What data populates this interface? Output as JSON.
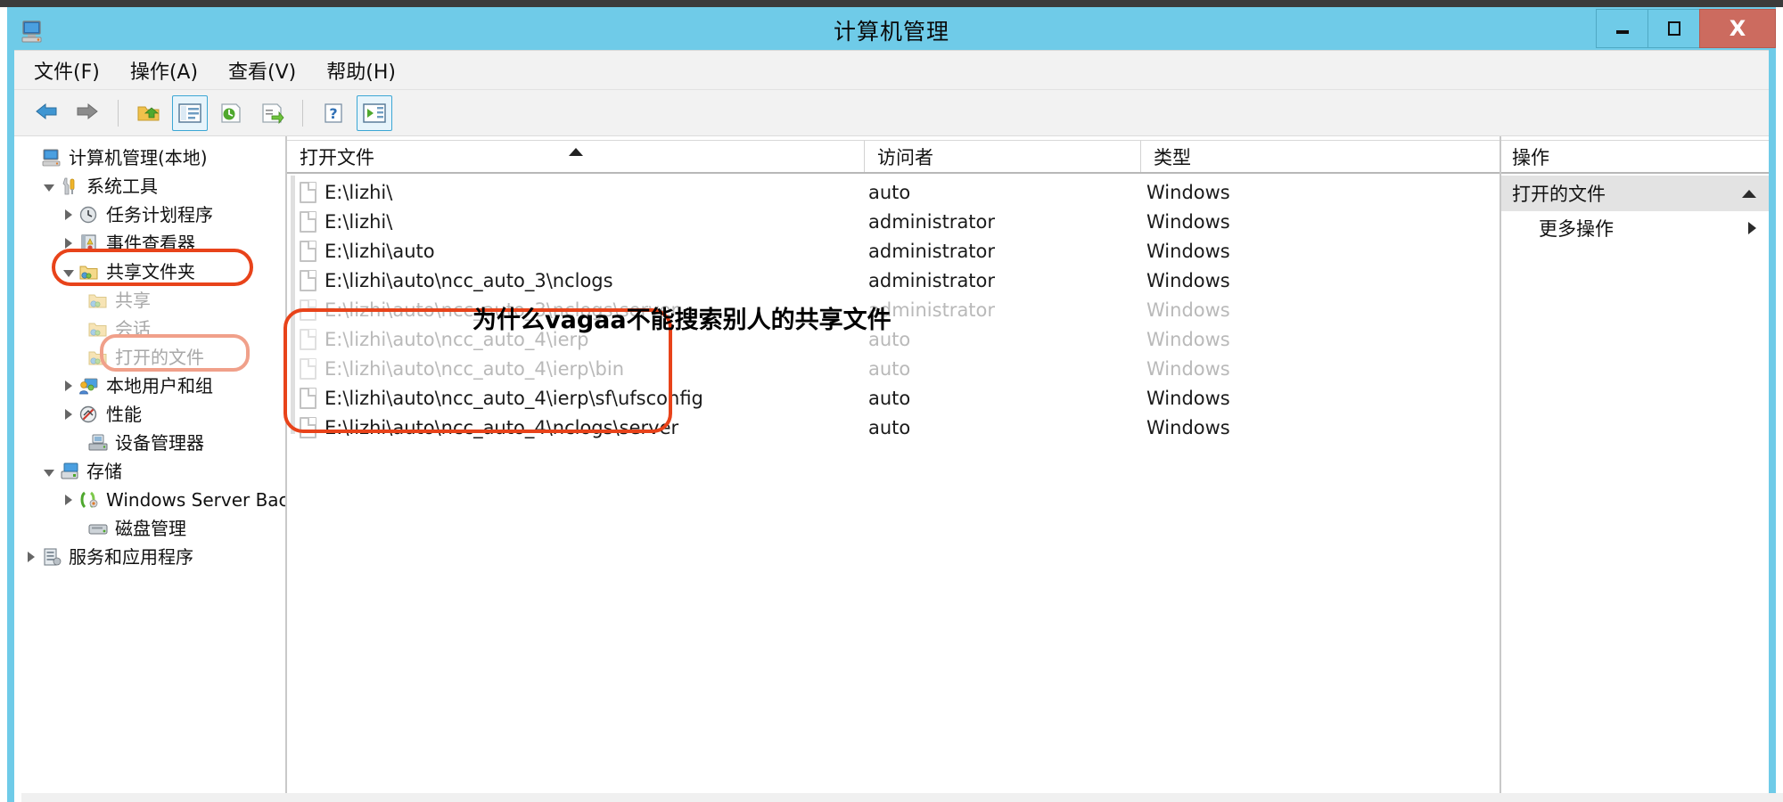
{
  "window": {
    "title": "计算机管理",
    "icon": "computer-management-icon",
    "controls": {
      "minimize": "–",
      "maximize": "□",
      "close": "X"
    }
  },
  "menubar": {
    "items": [
      {
        "label": "文件(F)",
        "name": "menu-file"
      },
      {
        "label": "操作(A)",
        "name": "menu-action"
      },
      {
        "label": "查看(V)",
        "name": "menu-view"
      },
      {
        "label": "帮助(H)",
        "name": "menu-help"
      }
    ]
  },
  "toolbar": {
    "buttons": [
      {
        "name": "back-icon",
        "glyph": "back"
      },
      {
        "name": "forward-icon",
        "glyph": "forward"
      },
      {
        "name": "up-folder-icon",
        "glyph": "folder-up"
      },
      {
        "name": "show-hide-tree-icon",
        "glyph": "tree-pane",
        "active": true
      },
      {
        "name": "refresh-icon",
        "glyph": "refresh"
      },
      {
        "name": "export-list-icon",
        "glyph": "export"
      },
      {
        "name": "help-icon",
        "glyph": "help"
      },
      {
        "name": "show-action-pane-icon",
        "glyph": "action-pane",
        "active": true
      }
    ]
  },
  "tree": {
    "items": [
      {
        "label": "计算机管理(本地)",
        "indent": 0,
        "arrow": "none",
        "icon": "computer-icon",
        "dim": false
      },
      {
        "label": "系统工具",
        "indent": 1,
        "arrow": "expanded",
        "icon": "tools-icon",
        "dim": false
      },
      {
        "label": "任务计划程序",
        "indent": 2,
        "arrow": "collapsed",
        "icon": "clock-icon",
        "dim": false
      },
      {
        "label": "事件查看器",
        "indent": 2,
        "arrow": "collapsed",
        "icon": "event-log-icon",
        "dim": false
      },
      {
        "label": "共享文件夹",
        "indent": 2,
        "arrow": "expanded",
        "icon": "shared-folder-icon",
        "dim": false
      },
      {
        "label": "共享",
        "indent": 3,
        "arrow": "none",
        "icon": "shared-folder-icon",
        "dim": true
      },
      {
        "label": "会话",
        "indent": 3,
        "arrow": "none",
        "icon": "shared-folder-icon",
        "dim": true
      },
      {
        "label": "打开的文件",
        "indent": 3,
        "arrow": "none",
        "icon": "shared-folder-icon",
        "dim": true
      },
      {
        "label": "本地用户和组",
        "indent": 2,
        "arrow": "collapsed",
        "icon": "users-icon",
        "dim": false
      },
      {
        "label": "性能",
        "indent": 2,
        "arrow": "collapsed",
        "icon": "performance-icon",
        "dim": false
      },
      {
        "label": "设备管理器",
        "indent": 2,
        "arrow": "none",
        "icon": "device-manager-icon",
        "dim": false
      },
      {
        "label": "存储",
        "indent": 1,
        "arrow": "expanded",
        "icon": "storage-icon",
        "dim": false
      },
      {
        "label": "Windows Server Back",
        "indent": 2,
        "arrow": "collapsed",
        "icon": "backup-icon",
        "dim": false
      },
      {
        "label": "磁盘管理",
        "indent": 2,
        "arrow": "none",
        "icon": "disk-icon",
        "dim": false
      },
      {
        "label": "服务和应用程序",
        "indent": 1,
        "arrow": "collapsed",
        "icon": "services-icon",
        "dim": false
      }
    ]
  },
  "list": {
    "columns": [
      {
        "label": "打开文件",
        "sorted": "asc"
      },
      {
        "label": "访问者",
        "sorted": "none"
      },
      {
        "label": "类型",
        "sorted": "none"
      }
    ],
    "rows": [
      {
        "file": "E:\\lizhi\\",
        "user": "auto",
        "type": "Windows",
        "dim": false
      },
      {
        "file": "E:\\lizhi\\",
        "user": "administrator",
        "type": "Windows",
        "dim": false
      },
      {
        "file": "E:\\lizhi\\auto",
        "user": "administrator",
        "type": "Windows",
        "dim": false
      },
      {
        "file": "E:\\lizhi\\auto\\ncc_auto_3\\nclogs",
        "user": "administrator",
        "type": "Windows",
        "dim": false
      },
      {
        "file": "E:\\lizhi\\auto\\ncc_auto_3\\nclogs\\server",
        "user": "administrator",
        "type": "Windows",
        "dim": true
      },
      {
        "file": "E:\\lizhi\\auto\\ncc_auto_4\\ierp",
        "user": "auto",
        "type": "Windows",
        "dim": true
      },
      {
        "file": "E:\\lizhi\\auto\\ncc_auto_4\\ierp\\bin",
        "user": "auto",
        "type": "Windows",
        "dim": true
      },
      {
        "file": "E:\\lizhi\\auto\\ncc_auto_4\\ierp\\sf\\ufsconfig",
        "user": "auto",
        "type": "Windows",
        "dim": false
      },
      {
        "file": "E:\\lizhi\\auto\\ncc_auto_4\\nclogs\\server",
        "user": "auto",
        "type": "Windows",
        "dim": false
      }
    ]
  },
  "actions": {
    "header": "操作",
    "group_label": "打开的文件",
    "more_actions": "更多操作"
  },
  "overlay": {
    "caption": "为什么vagaa不能搜索别人的共享文件"
  },
  "colors": {
    "titlebar": "#6fcbe8",
    "close_button": "#cc6b5f",
    "annotation_red": "#e8431a",
    "annotation_soft": "#f0a08a",
    "toolbar_active_border": "#3ca7d4"
  }
}
